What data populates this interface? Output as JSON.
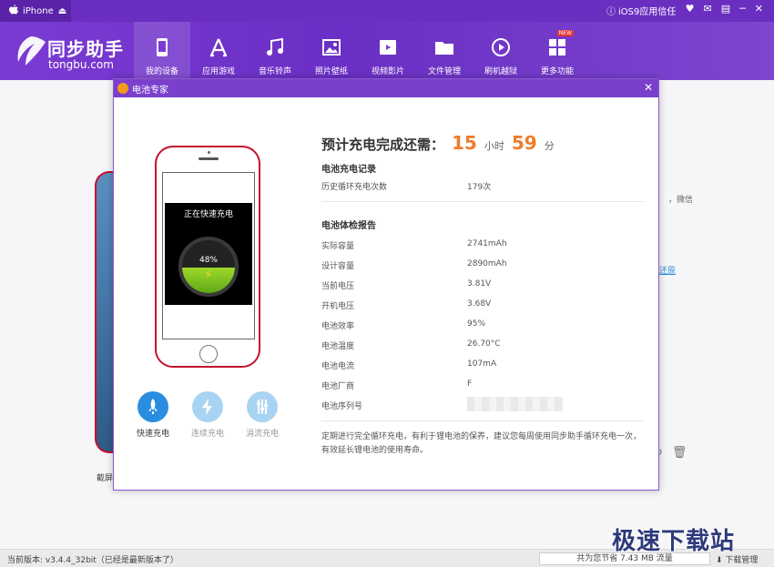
{
  "titlebar": {
    "device": "iPhone",
    "trust": "iOS9应用信任"
  },
  "header": {
    "logo_title": "同步助手",
    "logo_sub": "tongbu.com",
    "nav": [
      {
        "label": "我的设备"
      },
      {
        "label": "应用游戏"
      },
      {
        "label": "音乐铃声"
      },
      {
        "label": "照片壁纸"
      },
      {
        "label": "视频影片"
      },
      {
        "label": "文件管理"
      },
      {
        "label": "刷机越狱"
      },
      {
        "label": "更多功能"
      }
    ],
    "new_badge": "NEW"
  },
  "background": {
    "text1": "截屏",
    "text2": "，微信",
    "text3": "还原"
  },
  "dialog": {
    "title": "电池专家",
    "charging_text": "正在快速充电",
    "battery_percent": "48%",
    "battery_level": 0.48,
    "modes": [
      {
        "label": "快速充电",
        "color": "#2a8ee0"
      },
      {
        "label": "连续充电",
        "color": "#a9d3f2"
      },
      {
        "label": "涓流充电",
        "color": "#a9d3f2"
      }
    ],
    "remaining": {
      "label": "预计充电完成还需：",
      "hours": "15",
      "hours_unit": "小时",
      "minutes": "59",
      "minutes_unit": "分"
    },
    "record_title": "电池充电记录",
    "cycle_label": "历史循环充电次数",
    "cycle_value": "179次",
    "report_title": "电池体检报告",
    "report": [
      {
        "k": "实际容量",
        "v": "2741mAh"
      },
      {
        "k": "设计容量",
        "v": "2890mAh"
      },
      {
        "k": "当前电压",
        "v": "3.81V"
      },
      {
        "k": "开机电压",
        "v": "3.68V"
      },
      {
        "k": "电池效率",
        "v": "95%"
      },
      {
        "k": "电池温度",
        "v": "26.70°C"
      },
      {
        "k": "电池电流",
        "v": "107mA"
      },
      {
        "k": "电池厂商",
        "v": "F"
      },
      {
        "k": "电池序列号",
        "v": ""
      }
    ],
    "tip": "定期进行完全循环充电，有利于锂电池的保养，建议您每周使用同步助手循环充电一次，有效延长锂电池的使用寿命。"
  },
  "status": {
    "version": "当前版本: v3.4.4_32bit（已经是最新版本了）",
    "saved": "共为您节省 7.43 MB 流量",
    "download": "下载管理"
  },
  "watermark": "极速下载站"
}
